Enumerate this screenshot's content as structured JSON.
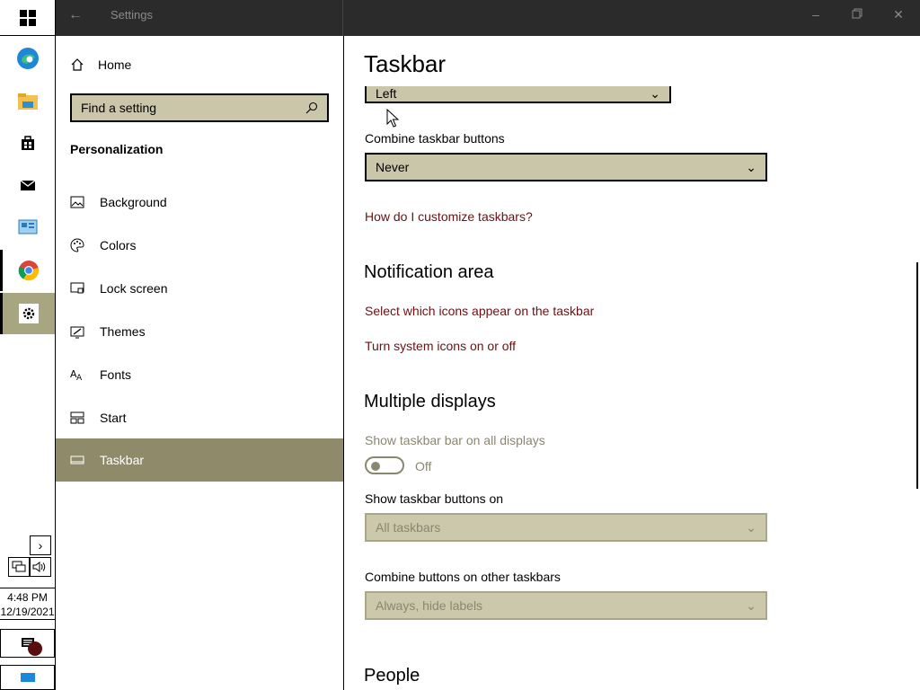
{
  "window": {
    "title": "Settings"
  },
  "taskbar": {
    "clock_time": "4:48 PM",
    "clock_date": "12/19/2021",
    "apps": [
      {
        "name": "Microsoft Edge",
        "icon": "edge-icon"
      },
      {
        "name": "File Explorer",
        "icon": "folder-icon"
      },
      {
        "name": "Microsoft Store",
        "icon": "store-icon"
      },
      {
        "name": "Mail",
        "icon": "mail-icon"
      },
      {
        "name": "Control Panel",
        "icon": "control-panel-icon"
      },
      {
        "name": "Google Chrome",
        "icon": "chrome-icon"
      },
      {
        "name": "Settings",
        "icon": "gear-icon"
      }
    ]
  },
  "nav": {
    "home_label": "Home",
    "search_placeholder": "Find a setting",
    "section_title": "Personalization",
    "items": [
      {
        "label": "Background",
        "icon": "picture-icon"
      },
      {
        "label": "Colors",
        "icon": "palette-icon"
      },
      {
        "label": "Lock screen",
        "icon": "lock-screen-icon"
      },
      {
        "label": "Themes",
        "icon": "themes-icon"
      },
      {
        "label": "Fonts",
        "icon": "fonts-icon"
      },
      {
        "label": "Start",
        "icon": "start-icon"
      },
      {
        "label": "Taskbar",
        "icon": "taskbar-icon"
      }
    ],
    "selected": "Taskbar"
  },
  "content": {
    "page_title": "Taskbar",
    "location_value": "Left",
    "combine_label": "Combine taskbar buttons",
    "combine_value": "Never",
    "customize_link": "How do I customize taskbars?",
    "notification_header": "Notification area",
    "notification_link1": "Select which icons appear on the taskbar",
    "notification_link2": "Turn system icons on or off",
    "multiple_header": "Multiple displays",
    "show_all_label": "Show taskbar bar on all displays",
    "toggle_state": "Off",
    "show_buttons_label": "Show taskbar buttons on",
    "show_buttons_value": "All taskbars",
    "combine_other_label": "Combine buttons on other taskbars",
    "combine_other_value": "Always, hide labels",
    "people_header": "People"
  },
  "colors": {
    "accent": "#8f8b6a",
    "field_bg": "#cac6aa",
    "link": "#6b1111",
    "titlebar": "#2b2b2b"
  }
}
